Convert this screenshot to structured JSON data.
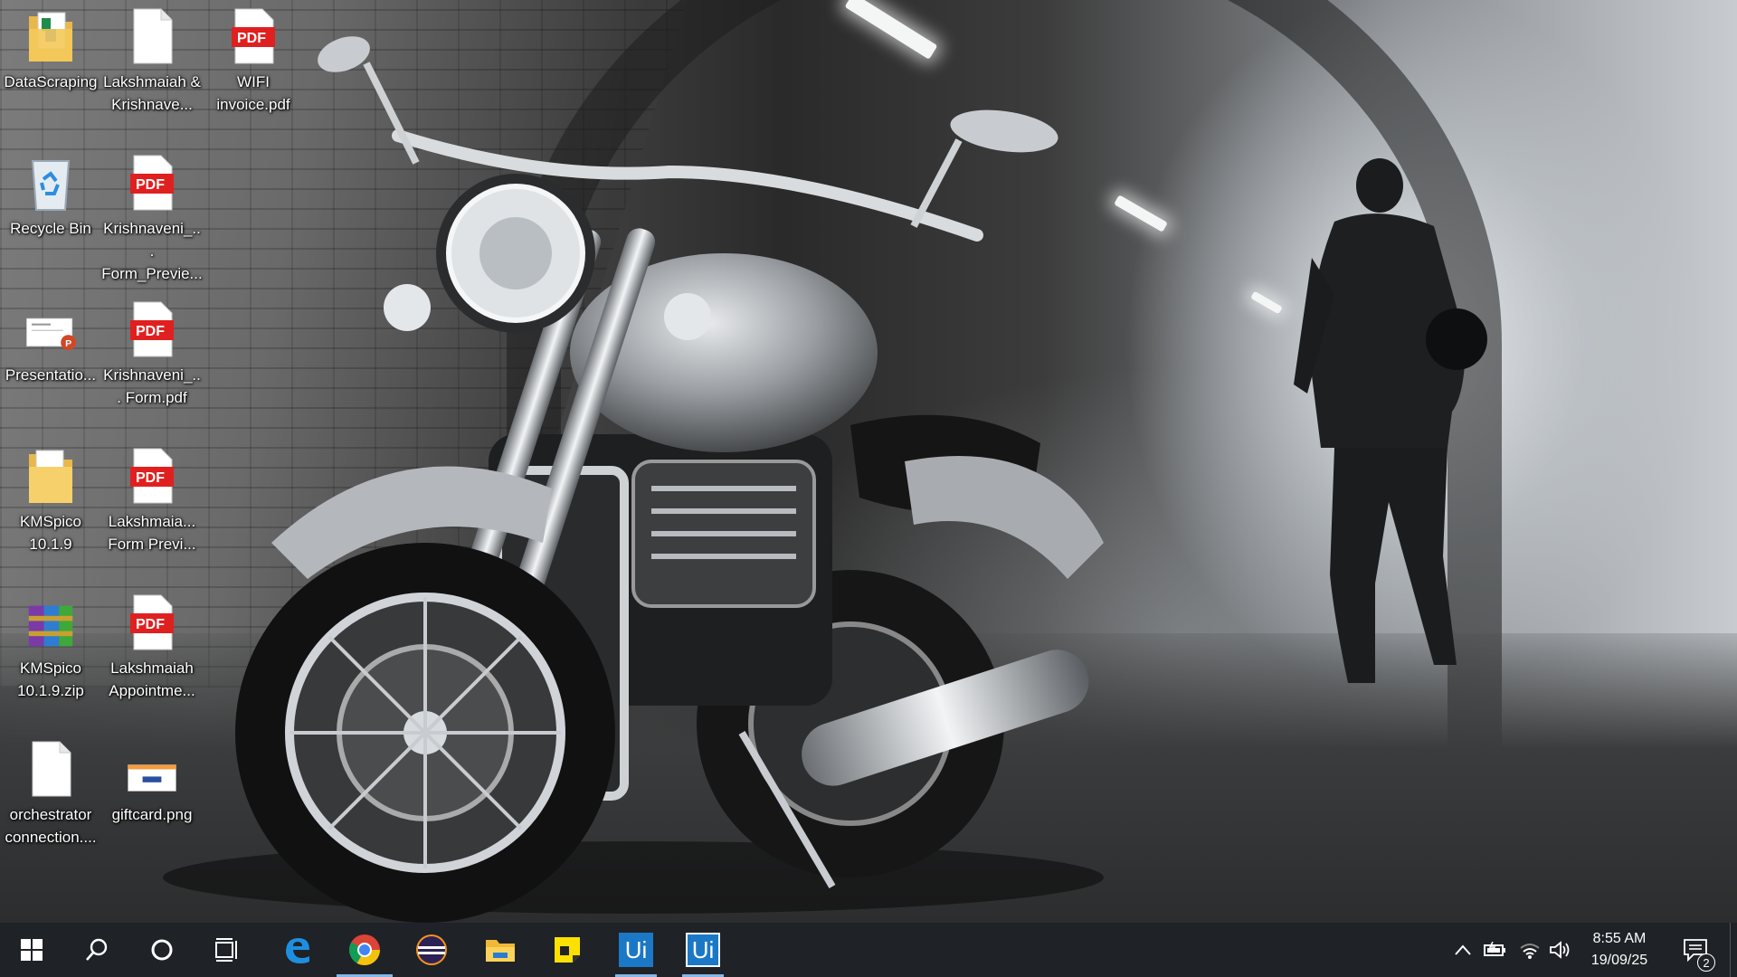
{
  "desktop": {
    "icons": [
      {
        "label": "DataScraping",
        "icon": "folder-with-spreadsheet-icon"
      },
      {
        "label": "Lakshmaiah & Krishnave...",
        "icon": "blank-document-icon"
      },
      {
        "label": "WIFI invoice.pdf",
        "icon": "pdf-file-icon",
        "badge": "PDF"
      },
      {
        "label": "Recycle Bin",
        "icon": "recycle-bin-icon"
      },
      {
        "label": "Krishnaveni_... Form_Previe...",
        "icon": "pdf-file-icon",
        "badge": "PDF"
      },
      {
        "label": "Presentatio...",
        "icon": "powerpoint-file-icon",
        "badge": "P"
      },
      {
        "label": "Krishnaveni_... Form.pdf",
        "icon": "pdf-file-icon",
        "badge": "PDF"
      },
      {
        "label": "KMSpico 10.1.9",
        "icon": "folder-icon"
      },
      {
        "label": "Lakshmaia... Form Previ...",
        "icon": "pdf-file-icon",
        "badge": "PDF"
      },
      {
        "label": "KMSpico 10.1.9.zip",
        "icon": "winrar-archive-icon"
      },
      {
        "label": "Lakshmaiah Appointme...",
        "icon": "pdf-file-icon",
        "badge": "PDF"
      },
      {
        "label": "orchestrator connection....",
        "icon": "blank-document-icon"
      },
      {
        "label": "giftcard.png",
        "icon": "image-file-icon"
      }
    ]
  },
  "taskbar": {
    "apps": [
      {
        "name": "start",
        "icon": "windows-start-icon"
      },
      {
        "name": "search",
        "icon": "search-icon"
      },
      {
        "name": "cortana",
        "icon": "cortana-circle-icon"
      },
      {
        "name": "task-view",
        "icon": "task-view-icon"
      },
      {
        "name": "edge",
        "icon": "edge-browser-icon"
      },
      {
        "name": "chrome",
        "icon": "chrome-browser-icon"
      },
      {
        "name": "eclipse",
        "icon": "eclipse-ide-icon"
      },
      {
        "name": "file-explorer",
        "icon": "file-explorer-icon"
      },
      {
        "name": "sticky-notes",
        "icon": "sticky-notes-icon"
      },
      {
        "name": "uipath-studio",
        "icon": "uipath-icon",
        "text": "Ui"
      },
      {
        "name": "uipath-assistant",
        "icon": "uipath-icon",
        "text": "Ui"
      }
    ],
    "tray": {
      "clock_time": "8:55 AM",
      "clock_date": "19/09/25",
      "notification_count": "2"
    }
  },
  "colors": {
    "taskbar_bg": "#1f2226",
    "active_indicator": "#86b6e6",
    "pdf_red": "#e02020",
    "uipath_blue": "#1b78c6"
  }
}
